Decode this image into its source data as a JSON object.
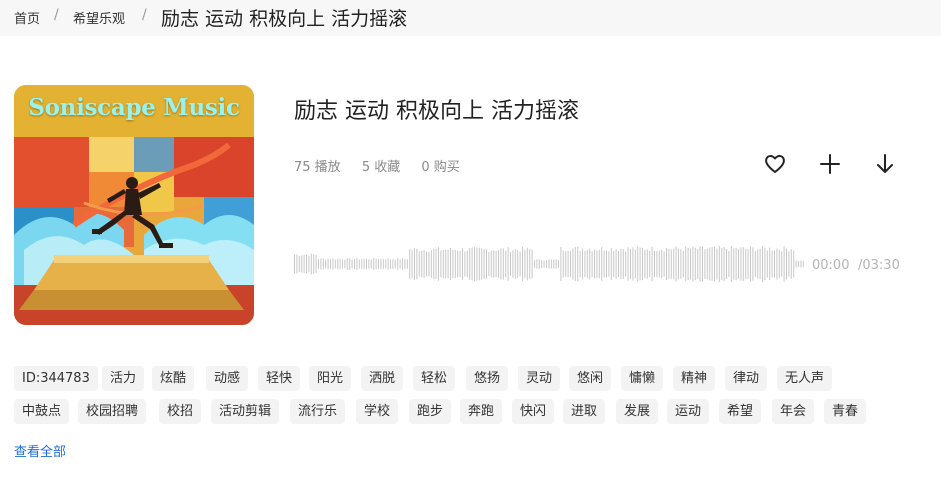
{
  "breadcrumb": {
    "home": "首页",
    "category": "希望乐观",
    "separator": "/",
    "current": "励志 运动 积极向上 活力摇滚"
  },
  "cover": {
    "brand_text": "Soniscape Music"
  },
  "track": {
    "title": "励志 运动 积极向上 活力摇滚",
    "plays": "75 播放",
    "favorites": "5 收藏",
    "purchases": "0 购买"
  },
  "actions": {
    "favorite_icon": "heart-icon",
    "add_icon": "plus-icon",
    "download_icon": "download-icon"
  },
  "player": {
    "current_time": "00:00",
    "total_time": "/03:30",
    "progress": 0
  },
  "tags_row1": [
    "ID:344783",
    "活力",
    "炫酷",
    "动感",
    "轻快",
    "阳光",
    "洒脱",
    "轻松",
    "悠扬",
    "灵动",
    "悠闲",
    "慵懒",
    "精神",
    "律动",
    "无人声"
  ],
  "tags_row2": [
    "中鼓点",
    "校园招聘",
    "校招",
    "活动剪辑",
    "流行乐",
    "学校",
    "跑步",
    "奔跑",
    "快闪",
    "进取",
    "发展",
    "运动",
    "希望",
    "年会",
    "青春"
  ],
  "view_all": "查看全部",
  "colors": {
    "link": "#1d6fd6",
    "muted_text": "#8a8a8a",
    "tag_bg": "#f3f3f3",
    "waveform": "#c8c8c8"
  }
}
